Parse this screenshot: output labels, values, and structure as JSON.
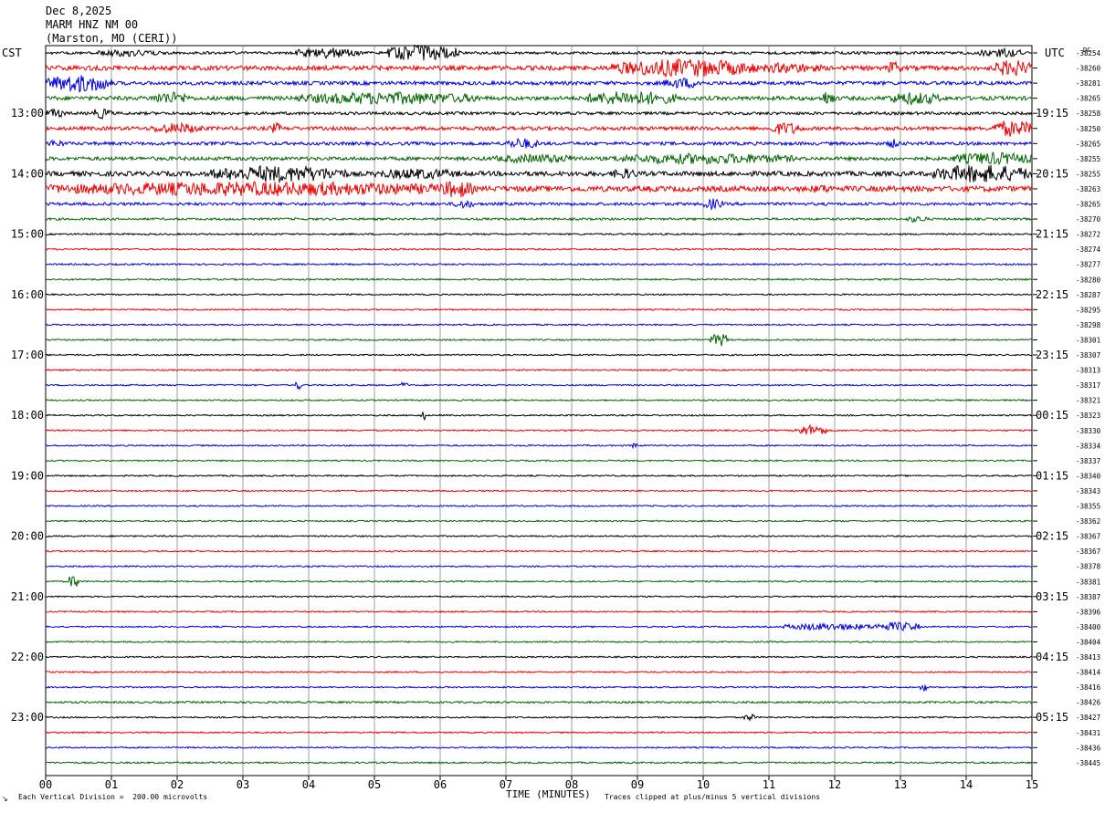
{
  "header": {
    "date": "Dec 8,2025",
    "station": "MARM HNZ NM 00",
    "location": "(Marston, MO (CERI))"
  },
  "left_timezone": "CST",
  "right_timezone": "UTC",
  "dc_label": "DC",
  "colors": {
    "traces": [
      "#000000",
      "#ee0000",
      "#0000dd",
      "#006600"
    ],
    "grid": "#888888",
    "axis": "#000000"
  },
  "footer": {
    "vertical_division": "Each Vertical Division =  200.00 microvolts",
    "clip_note": "Traces clipped at plus/minus 5 vertical divisions",
    "corner_mark": "↘"
  },
  "chart_data": {
    "type": "line",
    "title": "",
    "xlabel": "TIME (MINUTES)",
    "ylabel": "",
    "xlim": [
      0,
      15
    ],
    "x_ticks": [
      "00",
      "01",
      "02",
      "03",
      "04",
      "05",
      "06",
      "07",
      "08",
      "09",
      "10",
      "11",
      "12",
      "13",
      "14",
      "15"
    ],
    "left_hour_labels": [
      "13:00",
      "14:00",
      "15:00",
      "16:00",
      "17:00",
      "18:00",
      "19:00",
      "20:00",
      "21:00",
      "22:00",
      "23:00"
    ],
    "right_hour_labels": [
      "19:15",
      "20:15",
      "21:15",
      "22:15",
      "23:15",
      "00:15",
      "01:15",
      "02:15",
      "03:15",
      "04:15",
      "05:15"
    ],
    "hour_label_first_trace": 4,
    "traces_per_hour": 4,
    "dc_offsets": [
      "-38254",
      "-38260",
      "-38281",
      "-38265",
      "-38258",
      "-38250",
      "-38265",
      "-38255",
      "-38255",
      "-38263",
      "-38265",
      "-38270",
      "-38272",
      "-38274",
      "-38277",
      "-38280",
      "-38287",
      "-38295",
      "-38298",
      "-38301",
      "-38307",
      "-38313",
      "-38317",
      "-38321",
      "-38323",
      "-38330",
      "-38334",
      "-38337",
      "-38340",
      "-38343",
      "-38355",
      "-38362",
      "-38367",
      "-38367",
      "-38378",
      "-38381",
      "-38387",
      "-38396",
      "-38400",
      "-38404",
      "-38413",
      "-38414",
      "-38416",
      "-38426",
      "-38427",
      "-38431",
      "-38436",
      "-38445"
    ],
    "trace_noise": [
      1.5,
      2.5,
      2.0,
      2.2,
      1.6,
      2.0,
      1.8,
      2.0,
      2.6,
      3.0,
      1.6,
      1.2,
      0.9,
      0.9,
      0.9,
      0.9,
      0.8,
      0.8,
      0.8,
      0.8,
      0.8,
      0.8,
      0.8,
      0.8,
      0.8,
      0.8,
      0.8,
      0.8,
      0.8,
      0.8,
      0.8,
      0.8,
      0.8,
      0.8,
      0.8,
      0.8,
      0.8,
      0.8,
      0.8,
      0.8,
      0.8,
      0.8,
      0.8,
      1.1,
      0.8,
      0.8,
      0.8,
      0.9
    ],
    "events": [
      {
        "trace": 0,
        "start": 0.8,
        "end": 1.8,
        "amp": 4
      },
      {
        "trace": 0,
        "start": 3.8,
        "end": 4.8,
        "amp": 6
      },
      {
        "trace": 0,
        "start": 5.2,
        "end": 6.3,
        "amp": 9
      },
      {
        "trace": 0,
        "start": 14.2,
        "end": 14.9,
        "amp": 5
      },
      {
        "trace": 1,
        "start": 8.6,
        "end": 10.8,
        "amp": 10
      },
      {
        "trace": 1,
        "start": 10.8,
        "end": 11.8,
        "amp": 6
      },
      {
        "trace": 1,
        "start": 12.8,
        "end": 13.0,
        "amp": 8
      },
      {
        "trace": 1,
        "start": 14.4,
        "end": 15.0,
        "amp": 9
      },
      {
        "trace": 2,
        "start": 0.0,
        "end": 1.0,
        "amp": 10
      },
      {
        "trace": 2,
        "start": 9.4,
        "end": 10.0,
        "amp": 6
      },
      {
        "trace": 3,
        "start": 1.6,
        "end": 2.2,
        "amp": 7
      },
      {
        "trace": 3,
        "start": 3.8,
        "end": 6.6,
        "amp": 7
      },
      {
        "trace": 3,
        "start": 8.2,
        "end": 9.6,
        "amp": 8
      },
      {
        "trace": 3,
        "start": 11.8,
        "end": 12.0,
        "amp": 9
      },
      {
        "trace": 3,
        "start": 12.8,
        "end": 13.6,
        "amp": 7
      },
      {
        "trace": 4,
        "start": 0.0,
        "end": 0.3,
        "amp": 5
      },
      {
        "trace": 4,
        "start": 0.7,
        "end": 1.0,
        "amp": 6
      },
      {
        "trace": 5,
        "start": 1.6,
        "end": 2.4,
        "amp": 6
      },
      {
        "trace": 5,
        "start": 3.4,
        "end": 3.6,
        "amp": 6
      },
      {
        "trace": 5,
        "start": 11.0,
        "end": 11.5,
        "amp": 7
      },
      {
        "trace": 5,
        "start": 14.4,
        "end": 15.0,
        "amp": 9
      },
      {
        "trace": 6,
        "start": 0.0,
        "end": 0.3,
        "amp": 4
      },
      {
        "trace": 6,
        "start": 7.0,
        "end": 7.5,
        "amp": 6
      },
      {
        "trace": 6,
        "start": 12.8,
        "end": 13.0,
        "amp": 5
      },
      {
        "trace": 7,
        "start": 6.8,
        "end": 8.2,
        "amp": 5
      },
      {
        "trace": 7,
        "start": 8.6,
        "end": 11.4,
        "amp": 6
      },
      {
        "trace": 7,
        "start": 13.8,
        "end": 15.0,
        "amp": 7
      },
      {
        "trace": 8,
        "start": 2.5,
        "end": 4.6,
        "amp": 9
      },
      {
        "trace": 8,
        "start": 5.0,
        "end": 6.3,
        "amp": 6
      },
      {
        "trace": 8,
        "start": 8.6,
        "end": 9.0,
        "amp": 6
      },
      {
        "trace": 8,
        "start": 13.5,
        "end": 15.0,
        "amp": 10
      },
      {
        "trace": 9,
        "start": 0.0,
        "end": 6.4,
        "amp": 8
      },
      {
        "trace": 9,
        "start": 6.0,
        "end": 6.5,
        "amp": 10
      },
      {
        "trace": 9,
        "start": 11.6,
        "end": 12.0,
        "amp": 5
      },
      {
        "trace": 10,
        "start": 6.2,
        "end": 6.5,
        "amp": 5
      },
      {
        "trace": 10,
        "start": 10.0,
        "end": 10.3,
        "amp": 6
      },
      {
        "trace": 11,
        "start": 13.1,
        "end": 13.4,
        "amp": 4
      },
      {
        "trace": 19,
        "start": 10.1,
        "end": 10.4,
        "amp": 7
      },
      {
        "trace": 22,
        "start": 3.8,
        "end": 3.9,
        "amp": 5
      },
      {
        "trace": 22,
        "start": 5.4,
        "end": 5.5,
        "amp": 4
      },
      {
        "trace": 24,
        "start": 5.7,
        "end": 5.8,
        "amp": 5
      },
      {
        "trace": 25,
        "start": 11.4,
        "end": 11.9,
        "amp": 6
      },
      {
        "trace": 26,
        "start": 8.9,
        "end": 9.0,
        "amp": 4
      },
      {
        "trace": 35,
        "start": 0.35,
        "end": 0.5,
        "amp": 9
      },
      {
        "trace": 38,
        "start": 11.2,
        "end": 12.6,
        "amp": 4
      },
      {
        "trace": 38,
        "start": 12.6,
        "end": 13.3,
        "amp": 5
      },
      {
        "trace": 42,
        "start": 13.3,
        "end": 13.4,
        "amp": 6
      },
      {
        "trace": 44,
        "start": 10.6,
        "end": 10.8,
        "amp": 4
      }
    ]
  }
}
